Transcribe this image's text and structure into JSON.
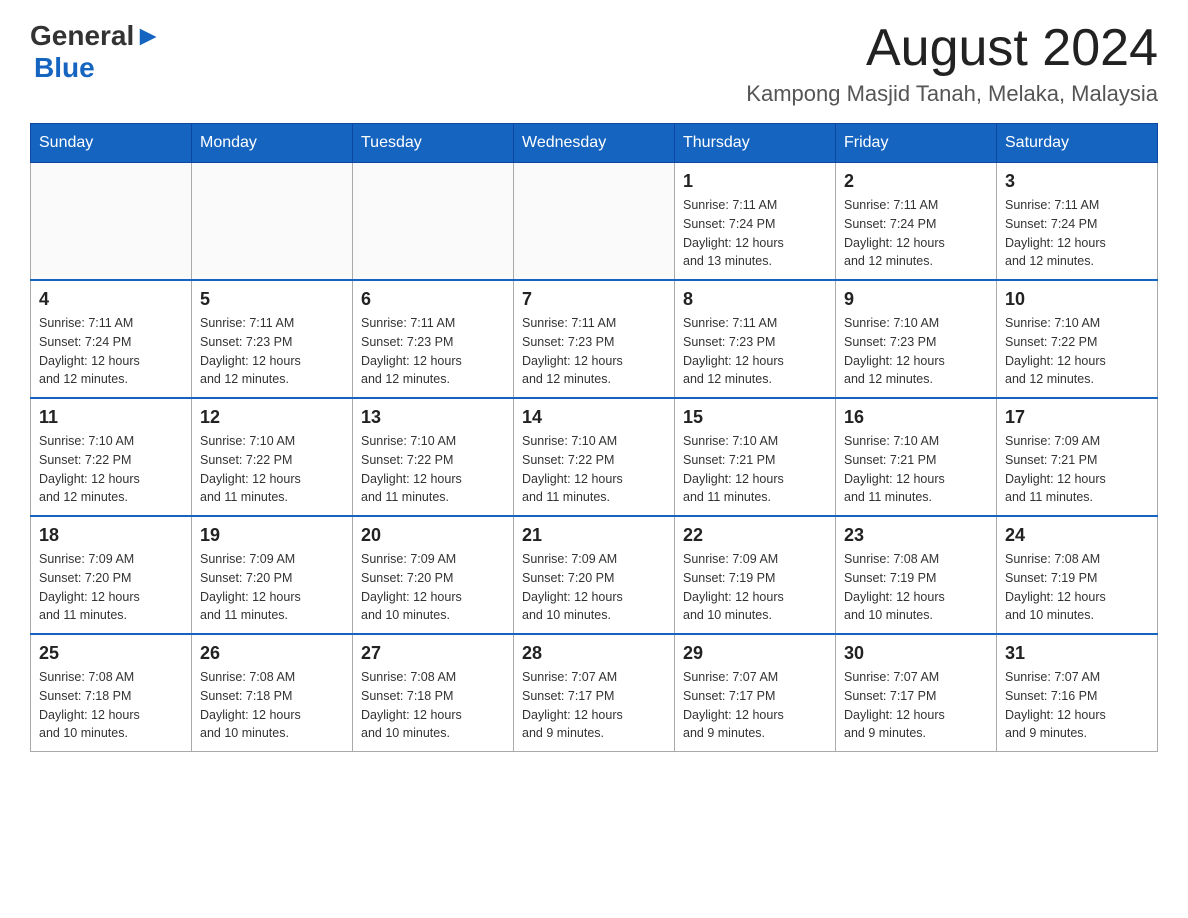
{
  "header": {
    "logo_general": "General",
    "logo_blue": "Blue",
    "month_title": "August 2024",
    "location": "Kampong Masjid Tanah, Melaka, Malaysia"
  },
  "weekdays": [
    "Sunday",
    "Monday",
    "Tuesday",
    "Wednesday",
    "Thursday",
    "Friday",
    "Saturday"
  ],
  "weeks": [
    [
      {
        "day": "",
        "info": ""
      },
      {
        "day": "",
        "info": ""
      },
      {
        "day": "",
        "info": ""
      },
      {
        "day": "",
        "info": ""
      },
      {
        "day": "1",
        "info": "Sunrise: 7:11 AM\nSunset: 7:24 PM\nDaylight: 12 hours\nand 13 minutes."
      },
      {
        "day": "2",
        "info": "Sunrise: 7:11 AM\nSunset: 7:24 PM\nDaylight: 12 hours\nand 12 minutes."
      },
      {
        "day": "3",
        "info": "Sunrise: 7:11 AM\nSunset: 7:24 PM\nDaylight: 12 hours\nand 12 minutes."
      }
    ],
    [
      {
        "day": "4",
        "info": "Sunrise: 7:11 AM\nSunset: 7:24 PM\nDaylight: 12 hours\nand 12 minutes."
      },
      {
        "day": "5",
        "info": "Sunrise: 7:11 AM\nSunset: 7:23 PM\nDaylight: 12 hours\nand 12 minutes."
      },
      {
        "day": "6",
        "info": "Sunrise: 7:11 AM\nSunset: 7:23 PM\nDaylight: 12 hours\nand 12 minutes."
      },
      {
        "day": "7",
        "info": "Sunrise: 7:11 AM\nSunset: 7:23 PM\nDaylight: 12 hours\nand 12 minutes."
      },
      {
        "day": "8",
        "info": "Sunrise: 7:11 AM\nSunset: 7:23 PM\nDaylight: 12 hours\nand 12 minutes."
      },
      {
        "day": "9",
        "info": "Sunrise: 7:10 AM\nSunset: 7:23 PM\nDaylight: 12 hours\nand 12 minutes."
      },
      {
        "day": "10",
        "info": "Sunrise: 7:10 AM\nSunset: 7:22 PM\nDaylight: 12 hours\nand 12 minutes."
      }
    ],
    [
      {
        "day": "11",
        "info": "Sunrise: 7:10 AM\nSunset: 7:22 PM\nDaylight: 12 hours\nand 12 minutes."
      },
      {
        "day": "12",
        "info": "Sunrise: 7:10 AM\nSunset: 7:22 PM\nDaylight: 12 hours\nand 11 minutes."
      },
      {
        "day": "13",
        "info": "Sunrise: 7:10 AM\nSunset: 7:22 PM\nDaylight: 12 hours\nand 11 minutes."
      },
      {
        "day": "14",
        "info": "Sunrise: 7:10 AM\nSunset: 7:22 PM\nDaylight: 12 hours\nand 11 minutes."
      },
      {
        "day": "15",
        "info": "Sunrise: 7:10 AM\nSunset: 7:21 PM\nDaylight: 12 hours\nand 11 minutes."
      },
      {
        "day": "16",
        "info": "Sunrise: 7:10 AM\nSunset: 7:21 PM\nDaylight: 12 hours\nand 11 minutes."
      },
      {
        "day": "17",
        "info": "Sunrise: 7:09 AM\nSunset: 7:21 PM\nDaylight: 12 hours\nand 11 minutes."
      }
    ],
    [
      {
        "day": "18",
        "info": "Sunrise: 7:09 AM\nSunset: 7:20 PM\nDaylight: 12 hours\nand 11 minutes."
      },
      {
        "day": "19",
        "info": "Sunrise: 7:09 AM\nSunset: 7:20 PM\nDaylight: 12 hours\nand 11 minutes."
      },
      {
        "day": "20",
        "info": "Sunrise: 7:09 AM\nSunset: 7:20 PM\nDaylight: 12 hours\nand 10 minutes."
      },
      {
        "day": "21",
        "info": "Sunrise: 7:09 AM\nSunset: 7:20 PM\nDaylight: 12 hours\nand 10 minutes."
      },
      {
        "day": "22",
        "info": "Sunrise: 7:09 AM\nSunset: 7:19 PM\nDaylight: 12 hours\nand 10 minutes."
      },
      {
        "day": "23",
        "info": "Sunrise: 7:08 AM\nSunset: 7:19 PM\nDaylight: 12 hours\nand 10 minutes."
      },
      {
        "day": "24",
        "info": "Sunrise: 7:08 AM\nSunset: 7:19 PM\nDaylight: 12 hours\nand 10 minutes."
      }
    ],
    [
      {
        "day": "25",
        "info": "Sunrise: 7:08 AM\nSunset: 7:18 PM\nDaylight: 12 hours\nand 10 minutes."
      },
      {
        "day": "26",
        "info": "Sunrise: 7:08 AM\nSunset: 7:18 PM\nDaylight: 12 hours\nand 10 minutes."
      },
      {
        "day": "27",
        "info": "Sunrise: 7:08 AM\nSunset: 7:18 PM\nDaylight: 12 hours\nand 10 minutes."
      },
      {
        "day": "28",
        "info": "Sunrise: 7:07 AM\nSunset: 7:17 PM\nDaylight: 12 hours\nand 9 minutes."
      },
      {
        "day": "29",
        "info": "Sunrise: 7:07 AM\nSunset: 7:17 PM\nDaylight: 12 hours\nand 9 minutes."
      },
      {
        "day": "30",
        "info": "Sunrise: 7:07 AM\nSunset: 7:17 PM\nDaylight: 12 hours\nand 9 minutes."
      },
      {
        "day": "31",
        "info": "Sunrise: 7:07 AM\nSunset: 7:16 PM\nDaylight: 12 hours\nand 9 minutes."
      }
    ]
  ]
}
